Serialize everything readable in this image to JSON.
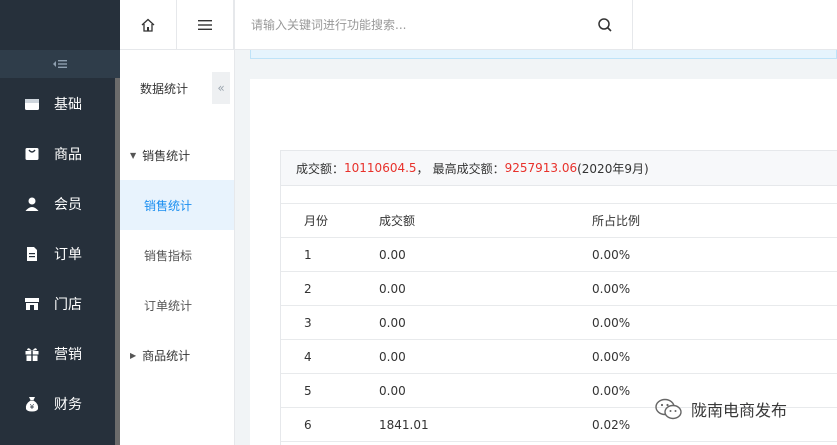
{
  "sidebar": {
    "collapse_icon": "collapse-lines-icon",
    "items": [
      {
        "label": "基础",
        "icon": "store-icon"
      },
      {
        "label": "商品",
        "icon": "bag-icon"
      },
      {
        "label": "会员",
        "icon": "user-icon"
      },
      {
        "label": "订单",
        "icon": "document-icon"
      },
      {
        "label": "门店",
        "icon": "shop-icon"
      },
      {
        "label": "营销",
        "icon": "gift-icon"
      },
      {
        "label": "财务",
        "icon": "money-bag-icon"
      }
    ]
  },
  "submenu": {
    "title": "数据统计",
    "groups": [
      {
        "label": "销售统计",
        "expanded": true
      },
      {
        "label": "商品统计",
        "expanded": false
      }
    ],
    "items": [
      {
        "label": "销售统计",
        "active": true
      },
      {
        "label": "销售指标",
        "active": false
      },
      {
        "label": "订单统计",
        "active": false
      }
    ]
  },
  "topbar": {
    "search_placeholder": "请输入关键词进行功能搜索..."
  },
  "summary": {
    "total_label": "成交额：",
    "total_value": "10110604.5",
    "sep": "，",
    "max_label": "最高成交额：",
    "max_value": "9257913.06",
    "max_period": " (2020年9月)"
  },
  "table": {
    "headers": [
      "月份",
      "成交额",
      "所占比例"
    ],
    "rows": [
      [
        "1",
        "0.00",
        "0.00%"
      ],
      [
        "2",
        "0.00",
        "0.00%"
      ],
      [
        "3",
        "0.00",
        "0.00%"
      ],
      [
        "4",
        "0.00",
        "0.00%"
      ],
      [
        "5",
        "0.00",
        "0.00%"
      ],
      [
        "6",
        "1841.01",
        "0.02%"
      ]
    ]
  },
  "watermark": "陇南电商发布",
  "colors": {
    "sidebar_bg": "#26303b",
    "accent": "#1a8ef0",
    "highlight_red": "#e8312b"
  }
}
